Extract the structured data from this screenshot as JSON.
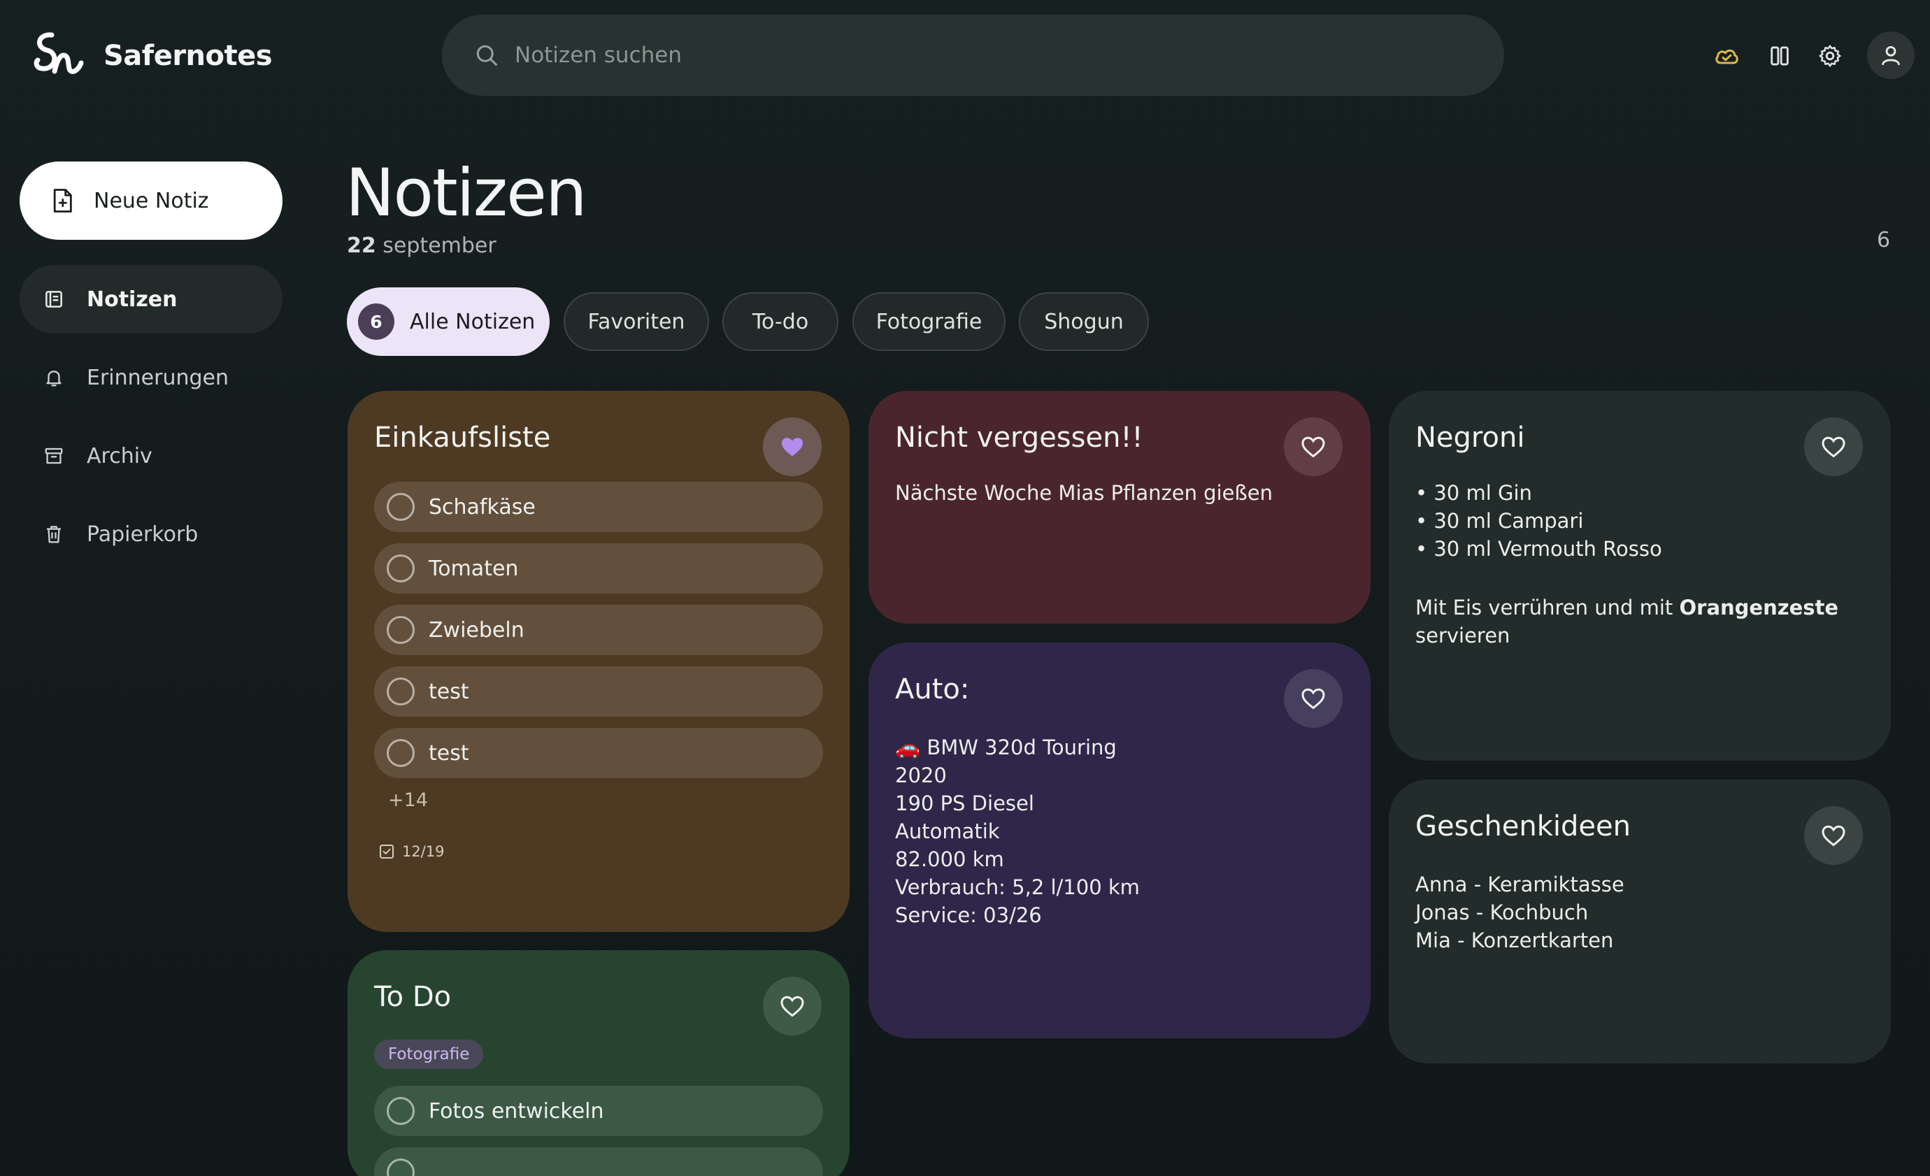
{
  "app": {
    "name": "Safernotes"
  },
  "search": {
    "placeholder": "Notizen suchen"
  },
  "header_icons": [
    "cloud-sync-icon",
    "columns-view-icon",
    "settings-gear-icon",
    "user-avatar-icon"
  ],
  "sidebar": {
    "new_note_label": "Neue Notiz",
    "items": [
      {
        "label": "Notizen",
        "icon": "notes-icon",
        "active": true
      },
      {
        "label": "Erinnerungen",
        "icon": "bell-icon",
        "active": false
      },
      {
        "label": "Archiv",
        "icon": "archive-icon",
        "active": false
      },
      {
        "label": "Papierkorb",
        "icon": "trash-icon",
        "active": false
      }
    ]
  },
  "main": {
    "title": "Notizen",
    "date_day": "22",
    "date_month": "september",
    "count": "6",
    "filters": [
      {
        "label": "Alle Notizen",
        "badge": "6",
        "active": true
      },
      {
        "label": "Favoriten"
      },
      {
        "label": "To-do"
      },
      {
        "label": "Fotografie"
      },
      {
        "label": "Shogun"
      }
    ]
  },
  "colors": {
    "accent_lavender": "#ece4f7",
    "fav_active": "#b48cf0",
    "card_einkauf": "#4e3a22",
    "card_nicht": "#4b252d",
    "card_auto": "#2f2649",
    "card_negroni": "#222c2a",
    "card_geschenk": "#222c2a",
    "card_todo": "#27442f"
  },
  "notes": {
    "einkauf": {
      "title": "Einkaufsliste",
      "favorite": true,
      "items": [
        "Schafkäse",
        "Tomaten",
        "Zwiebeln",
        "test",
        "test"
      ],
      "more": "+14",
      "progress": "12/19"
    },
    "nicht": {
      "title": "Nicht vergessen!!",
      "body": "Nächste Woche Mias Pflanzen gießen"
    },
    "auto": {
      "title": "Auto:",
      "emoji": "🚗",
      "lines": [
        "BMW 320d Touring",
        "2020",
        "190 PS Diesel",
        "Automatik",
        "82.000 km",
        "Verbrauch: 5,2 l/100 km",
        "Service: 03/26"
      ]
    },
    "negroni": {
      "title": "Negroni",
      "lines": [
        "• 30 ml Gin",
        "• 30 ml Campari",
        "• 30 ml Vermouth Rosso"
      ],
      "text_before": "Mit Eis verrühren und mit ",
      "text_bold": "Orangenzeste",
      "text_after": "servieren"
    },
    "geschenk": {
      "title": "Geschenkideen",
      "lines": [
        "Anna - Keramiktasse",
        "Jonas - Kochbuch",
        "Mia - Konzertkarten"
      ]
    },
    "todo": {
      "title": "To Do",
      "tag": "Fotografie",
      "items": [
        "Fotos entwickeln"
      ]
    }
  }
}
